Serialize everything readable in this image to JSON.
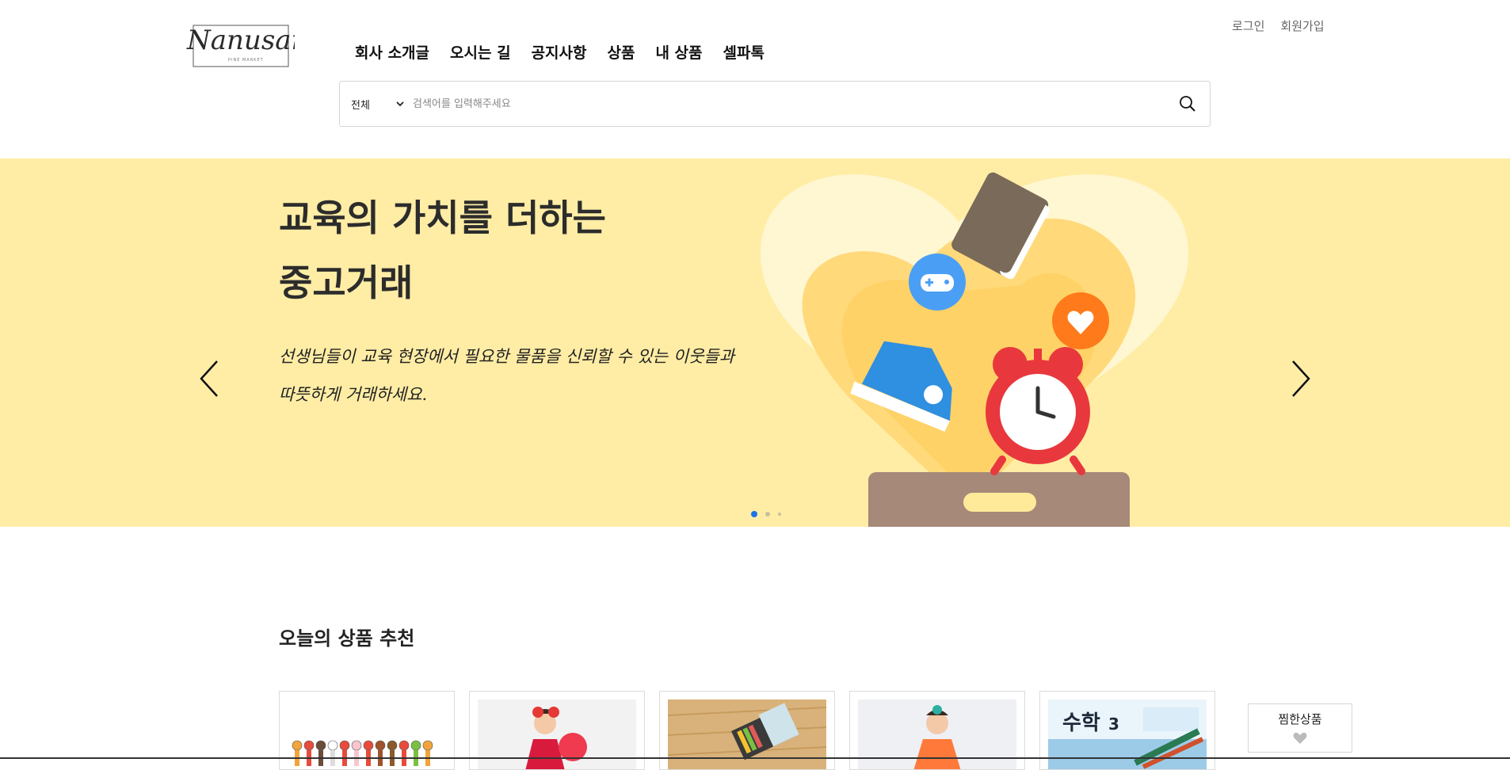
{
  "header": {
    "logo_text": "Nanusam",
    "logo_sub": "PINE MARKET",
    "nav": [
      "회사 소개글",
      "오시는 길",
      "공지사항",
      "상품",
      "내 상품",
      "셀파톡"
    ],
    "login": "로그인",
    "signup": "회원가입"
  },
  "search": {
    "category": "전체",
    "placeholder": "검색어를 입력해주세요"
  },
  "banner": {
    "title_line1": "교육의 가치를 더하는",
    "title_line2": "중고거래",
    "desc_line1": "선생님들이 교육 현장에서 필요한 물품을 신뢰할 수 있는 이웃들과",
    "desc_line2": "따뜻하게 거래하세요.",
    "background": "#ffeda5",
    "slides": 3,
    "active_slide": 1,
    "active_dot_color": "#1a73e8"
  },
  "recommend": {
    "title": "오늘의 상품 추천",
    "products": [
      "finger-puppets",
      "girl-red-dress",
      "crayons-box",
      "girl-orange-dress",
      "math-textbook"
    ],
    "textbook_label": "수학",
    "textbook_number": "3"
  },
  "wishlist": {
    "label": "찜한상품"
  }
}
